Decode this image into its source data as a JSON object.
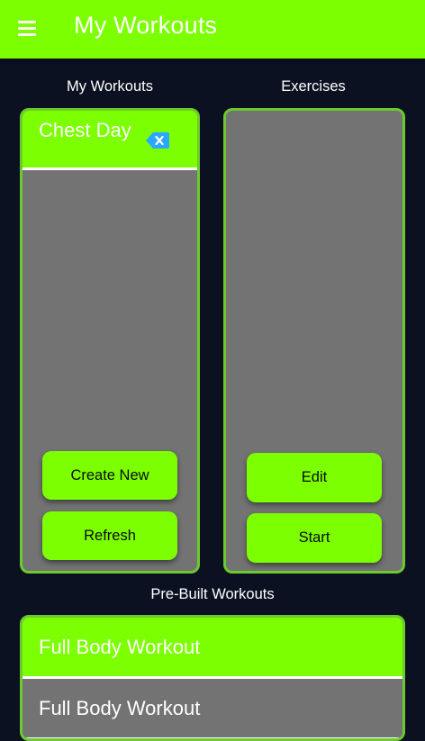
{
  "app_bar": {
    "title": "My Workouts",
    "menu_icon": "hamburger-menu-icon",
    "color": "#7cff00"
  },
  "colors": {
    "background": "#0b1121",
    "accent": "#7cff00",
    "panel": "#737373",
    "panel_border": "#6cc92e",
    "delete_icon": "#2aa8ff"
  },
  "my_workouts": {
    "heading": "My Workouts",
    "items": [
      {
        "name": "Chest Day",
        "delete_icon": "backspace-delete-icon"
      }
    ],
    "create_label": "Create New",
    "refresh_label": "Refresh"
  },
  "exercises": {
    "heading": "Exercises",
    "edit_label": "Edit",
    "start_label": "Start"
  },
  "prebuilt": {
    "heading": "Pre-Built Workouts",
    "items": [
      {
        "name": "Full Body Workout"
      },
      {
        "name": "Full Body Workout"
      }
    ]
  }
}
